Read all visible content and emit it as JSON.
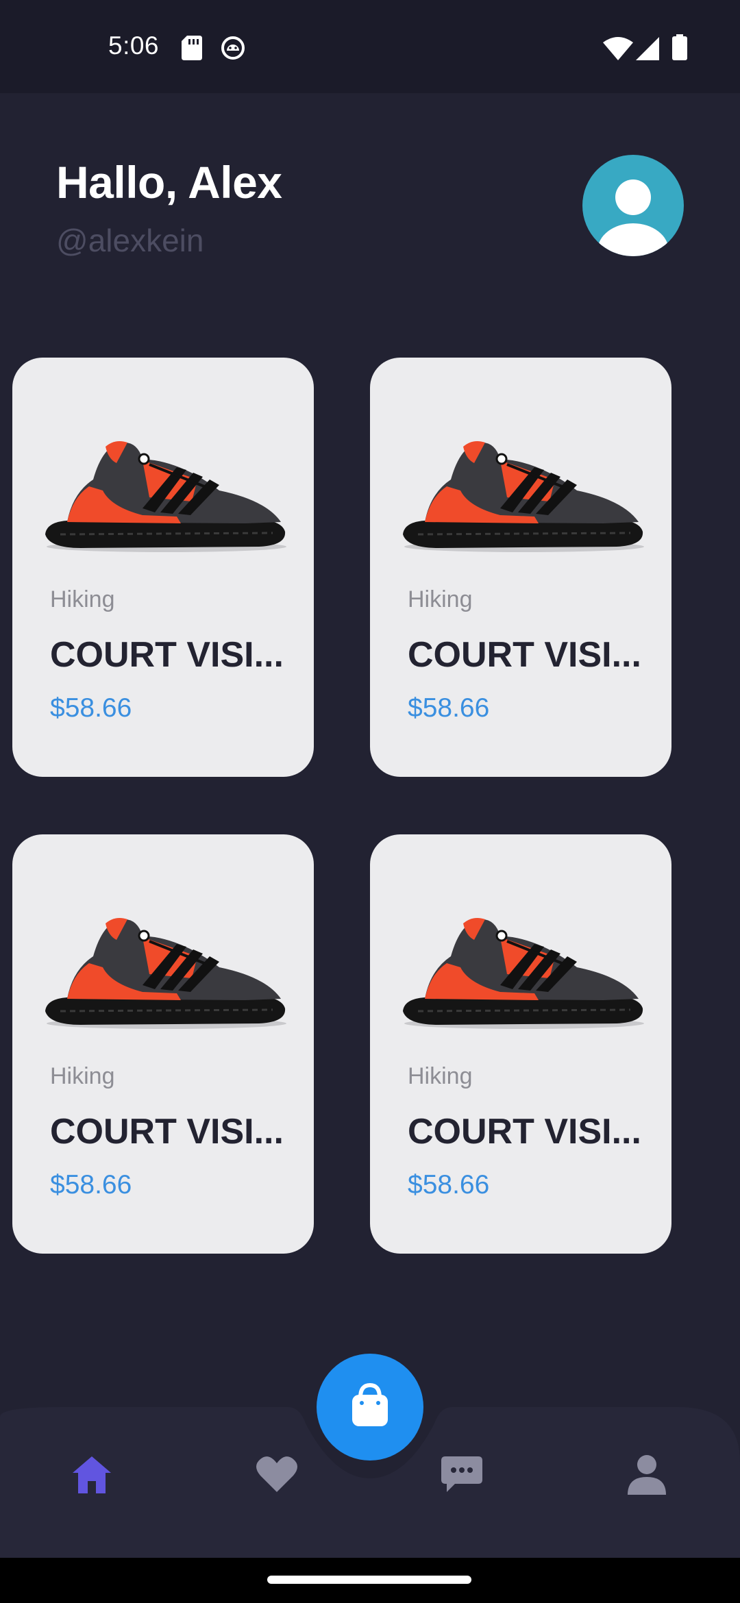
{
  "status_bar": {
    "time": "5:06",
    "icons_left": [
      "sd-card-icon",
      "android-debug-icon"
    ],
    "icons_right": [
      "wifi-icon",
      "signal-icon",
      "battery-icon"
    ]
  },
  "header": {
    "greeting": "Hallo, Alex",
    "handle": "@alexkein",
    "avatar_icon": "person-icon"
  },
  "products": [
    {
      "category": "Hiking",
      "name": "COURT VISI...",
      "price": "$58.66"
    },
    {
      "category": "Hiking",
      "name": "COURT VISI...",
      "price": "$58.66"
    },
    {
      "category": "Hiking",
      "name": "COURT VISI...",
      "price": "$58.66"
    },
    {
      "category": "Hiking",
      "name": "COURT VISI...",
      "price": "$58.66"
    }
  ],
  "bottom_nav": {
    "fab_icon": "shopping-bag-icon",
    "items": [
      {
        "icon": "home-icon",
        "active": true
      },
      {
        "icon": "heart-icon",
        "active": false
      },
      {
        "icon": "chat-icon",
        "active": false
      },
      {
        "icon": "profile-icon",
        "active": false
      }
    ]
  },
  "colors": {
    "background": "#222232",
    "card": "#ececee",
    "accent_price": "#3a8fe0",
    "fab": "#1f8ff0",
    "nav_active": "#6155e0",
    "nav_inactive": "#8c8ca0",
    "avatar": "#38a9c3"
  }
}
